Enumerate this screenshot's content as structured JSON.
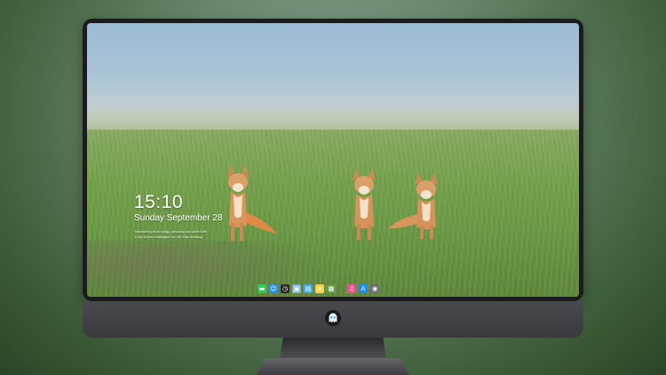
{
  "lockscreen": {
    "time": "15:10",
    "date": "Sunday September 28",
    "caption_line1": "Interesting technology, amazing wonderful life",
    "caption_line2": "Lock screen wallpaper for the Mac desktop"
  },
  "dock": {
    "icons": [
      {
        "name": "messages-icon",
        "glyph": "▬",
        "color": "#34c759"
      },
      {
        "name": "finder-icon",
        "glyph": "☺",
        "color": "#2a8ff0"
      },
      {
        "name": "clock-icon",
        "glyph": "◷",
        "color": "#2c2c2e"
      },
      {
        "name": "preview-icon",
        "glyph": "▣",
        "color": "#8ab4d8"
      },
      {
        "name": "movie-icon",
        "glyph": "▤",
        "color": "#4aa8e0"
      },
      {
        "name": "notes-icon",
        "glyph": "≡",
        "color": "#f5d44a"
      },
      {
        "name": "photos-icon",
        "glyph": "▦",
        "color": "#6a9a4a"
      },
      {
        "name": "music-icon",
        "glyph": "♫",
        "color": "#f0508c"
      },
      {
        "name": "app-store-icon",
        "glyph": "A",
        "color": "#1d8bf0"
      },
      {
        "name": "camera-icon",
        "glyph": "◉",
        "color": "#6e6e73"
      }
    ]
  },
  "colors": {
    "screen_sky": "#9bbbd5",
    "grass": "#6d9847",
    "bezel": "#1c1c1e",
    "chin": "#3a3a3e"
  }
}
